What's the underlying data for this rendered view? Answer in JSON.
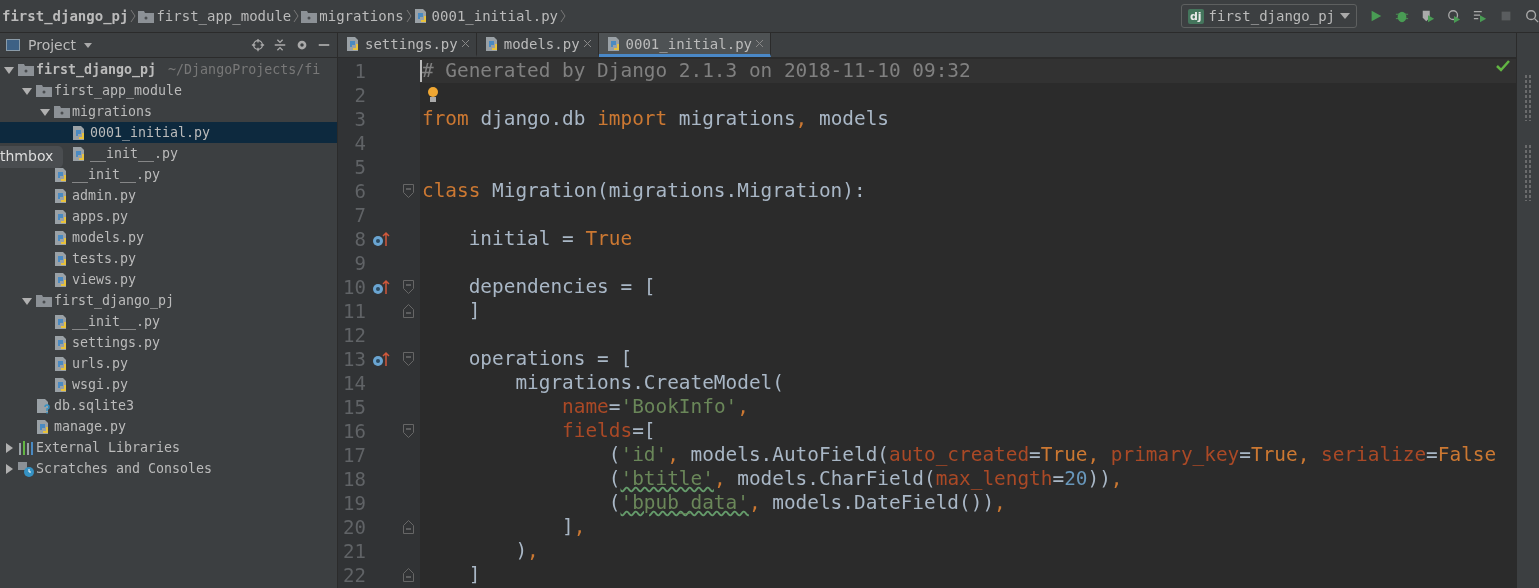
{
  "breadcrumbs": [
    {
      "label": "first_django_pj",
      "kind": "project"
    },
    {
      "label": "first_app_module",
      "kind": "folder"
    },
    {
      "label": "migrations",
      "kind": "folder"
    },
    {
      "label": "0001_initial.py",
      "kind": "python"
    }
  ],
  "run_config": {
    "label": "first_django_pj",
    "badge": "dj"
  },
  "project_panel": {
    "title": "Project",
    "overlay_tag": "thmbox",
    "tree": [
      {
        "name": "first_django_pj",
        "kind": "folder",
        "bold": true,
        "path": "~/DjangoProjects/fi",
        "expanded": true,
        "selected": false,
        "children": [
          {
            "name": "first_app_module",
            "kind": "folder",
            "bold": false,
            "expanded": true,
            "selected": false,
            "children": [
              {
                "name": "migrations",
                "kind": "folder",
                "bold": false,
                "expanded": true,
                "selected": false,
                "children": [
                  {
                    "name": "0001_initial.py",
                    "kind": "python",
                    "bold": false,
                    "selected": true
                  },
                  {
                    "name": "__init__.py",
                    "kind": "python",
                    "bold": false,
                    "selected": false
                  }
                ]
              },
              {
                "name": "__init__.py",
                "kind": "python",
                "bold": false,
                "selected": false
              },
              {
                "name": "admin.py",
                "kind": "python",
                "bold": false,
                "selected": false
              },
              {
                "name": "apps.py",
                "kind": "python",
                "bold": false,
                "selected": false
              },
              {
                "name": "models.py",
                "kind": "python",
                "bold": false,
                "selected": false
              },
              {
                "name": "tests.py",
                "kind": "python",
                "bold": false,
                "selected": false
              },
              {
                "name": "views.py",
                "kind": "python",
                "bold": false,
                "selected": false
              }
            ]
          },
          {
            "name": "first_django_pj",
            "kind": "folder",
            "bold": false,
            "expanded": true,
            "selected": false,
            "children": [
              {
                "name": "__init__.py",
                "kind": "python",
                "bold": false,
                "selected": false
              },
              {
                "name": "settings.py",
                "kind": "python",
                "bold": false,
                "selected": false
              },
              {
                "name": "urls.py",
                "kind": "python",
                "bold": false,
                "selected": false
              },
              {
                "name": "wsgi.py",
                "kind": "python",
                "bold": false,
                "selected": false
              }
            ]
          },
          {
            "name": "db.sqlite3",
            "kind": "unknown",
            "bold": false,
            "selected": false
          },
          {
            "name": "manage.py",
            "kind": "python",
            "bold": false,
            "selected": false
          }
        ]
      },
      {
        "name": "External Libraries",
        "kind": "library",
        "bold": false,
        "expanded": false,
        "selected": false
      },
      {
        "name": "Scratches and Consoles",
        "kind": "scratches",
        "bold": false,
        "expanded": false,
        "selected": false
      }
    ]
  },
  "tabs": [
    {
      "label": "settings.py",
      "selected": false
    },
    {
      "label": "models.py",
      "selected": false
    },
    {
      "label": "0001_initial.py",
      "selected": true
    }
  ],
  "editor": {
    "lines": [
      {
        "number": "1",
        "current": true,
        "override": false,
        "bulb": false,
        "fold_start": false,
        "fold_end": false,
        "tokens": [
          {
            "kind": "comment",
            "t": "# Generated by Django 2.1.3 on 2018-11-10 09:32"
          }
        ]
      },
      {
        "number": "2",
        "current": false,
        "override": false,
        "bulb": true,
        "fold_start": false,
        "fold_end": false
      },
      {
        "number": "3",
        "current": false,
        "override": false,
        "bulb": false,
        "fold_start": false,
        "fold_end": false,
        "tokens": [
          {
            "kind": "keyword",
            "t": "from"
          },
          {
            "kind": "plain",
            "t": " django.db "
          },
          {
            "kind": "keyword",
            "t": "import"
          },
          {
            "kind": "plain",
            "t": " migrations"
          },
          {
            "kind": "keyword",
            "t": ","
          },
          {
            "kind": "plain",
            "t": " models"
          }
        ]
      },
      {
        "number": "4",
        "current": false,
        "override": false,
        "bulb": false,
        "fold_start": false,
        "fold_end": false
      },
      {
        "number": "5",
        "current": false,
        "override": false,
        "bulb": false,
        "fold_start": false,
        "fold_end": false
      },
      {
        "number": "6",
        "current": false,
        "override": false,
        "bulb": false,
        "fold_start": true,
        "fold_end": false,
        "tokens": [
          {
            "kind": "keyword",
            "t": "class"
          },
          {
            "kind": "plain",
            "t": " Migration(migrations.Migration):"
          }
        ]
      },
      {
        "number": "7",
        "current": false,
        "override": false,
        "bulb": false,
        "fold_start": false,
        "fold_end": false
      },
      {
        "number": "8",
        "current": false,
        "override": true,
        "bulb": false,
        "fold_start": false,
        "fold_end": false,
        "tokens": [
          {
            "kind": "plain",
            "t": "    initial = "
          },
          {
            "kind": "keyword",
            "t": "True"
          }
        ]
      },
      {
        "number": "9",
        "current": false,
        "override": false,
        "bulb": false,
        "fold_start": false,
        "fold_end": false
      },
      {
        "number": "10",
        "current": false,
        "override": true,
        "bulb": false,
        "fold_start": true,
        "fold_end": false,
        "tokens": [
          {
            "kind": "plain",
            "t": "    dependencies = ["
          }
        ]
      },
      {
        "number": "11",
        "current": false,
        "override": false,
        "bulb": false,
        "fold_start": false,
        "fold_end": true,
        "tokens": [
          {
            "kind": "plain",
            "t": "    ]"
          }
        ]
      },
      {
        "number": "12",
        "current": false,
        "override": false,
        "bulb": false,
        "fold_start": false,
        "fold_end": false
      },
      {
        "number": "13",
        "current": false,
        "override": true,
        "bulb": false,
        "fold_start": true,
        "fold_end": false,
        "tokens": [
          {
            "kind": "plain",
            "t": "    operations = ["
          }
        ]
      },
      {
        "number": "14",
        "current": false,
        "override": false,
        "bulb": false,
        "fold_start": false,
        "fold_end": false,
        "tokens": [
          {
            "kind": "plain",
            "t": "        migrations.CreateModel("
          }
        ]
      },
      {
        "number": "15",
        "current": false,
        "override": false,
        "bulb": false,
        "fold_start": false,
        "fold_end": false,
        "tokens": [
          {
            "kind": "param",
            "t": "            name"
          },
          {
            "kind": "plain",
            "t": "="
          },
          {
            "kind": "string",
            "t": "'BookInfo'"
          },
          {
            "kind": "keyword",
            "t": ","
          }
        ]
      },
      {
        "number": "16",
        "current": false,
        "override": false,
        "bulb": false,
        "fold_start": true,
        "fold_end": false,
        "tokens": [
          {
            "kind": "param",
            "t": "            fields"
          },
          {
            "kind": "plain",
            "t": "=["
          }
        ]
      },
      {
        "number": "17",
        "current": false,
        "override": false,
        "bulb": false,
        "fold_start": false,
        "fold_end": false,
        "tokens": [
          {
            "kind": "plain",
            "t": "                ("
          },
          {
            "kind": "string",
            "t": "'id'"
          },
          {
            "kind": "keyword",
            "t": ","
          },
          {
            "kind": "plain",
            "t": " models.AutoField("
          },
          {
            "kind": "param",
            "t": "auto_created"
          },
          {
            "kind": "plain",
            "t": "="
          },
          {
            "kind": "keyword",
            "t": "True"
          },
          {
            "kind": "keyword",
            "t": ", "
          },
          {
            "kind": "param",
            "t": "primary_key"
          },
          {
            "kind": "plain",
            "t": "="
          },
          {
            "kind": "keyword",
            "t": "True"
          },
          {
            "kind": "keyword",
            "t": ", "
          },
          {
            "kind": "param",
            "t": "serialize"
          },
          {
            "kind": "plain",
            "t": "="
          },
          {
            "kind": "keyword",
            "t": "False"
          }
        ]
      },
      {
        "number": "18",
        "current": false,
        "override": false,
        "bulb": false,
        "fold_start": false,
        "fold_end": false,
        "tokens": [
          {
            "kind": "plain",
            "t": "                ("
          },
          {
            "kind": "typo",
            "t": "'btitle'"
          },
          {
            "kind": "keyword",
            "t": ","
          },
          {
            "kind": "plain",
            "t": " models.CharField("
          },
          {
            "kind": "param",
            "t": "max_length"
          },
          {
            "kind": "plain",
            "t": "="
          },
          {
            "kind": "number",
            "t": "20"
          },
          {
            "kind": "plain",
            "t": "))"
          },
          {
            "kind": "keyword",
            "t": ","
          }
        ]
      },
      {
        "number": "19",
        "current": false,
        "override": false,
        "bulb": false,
        "fold_start": false,
        "fold_end": false,
        "tokens": [
          {
            "kind": "plain",
            "t": "                ("
          },
          {
            "kind": "typo",
            "t": "'bpub_data'"
          },
          {
            "kind": "keyword",
            "t": ","
          },
          {
            "kind": "plain",
            "t": " models.DateField())"
          },
          {
            "kind": "keyword",
            "t": ","
          }
        ]
      },
      {
        "number": "20",
        "current": false,
        "override": false,
        "bulb": false,
        "fold_start": false,
        "fold_end": true,
        "tokens": [
          {
            "kind": "plain",
            "t": "            ]"
          },
          {
            "kind": "keyword",
            "t": ","
          }
        ]
      },
      {
        "number": "21",
        "current": false,
        "override": false,
        "bulb": false,
        "fold_start": false,
        "fold_end": false,
        "tokens": [
          {
            "kind": "plain",
            "t": "        )"
          },
          {
            "kind": "keyword",
            "t": ","
          }
        ]
      },
      {
        "number": "22",
        "current": false,
        "override": false,
        "bulb": false,
        "fold_start": false,
        "fold_end": true,
        "tokens": [
          {
            "kind": "plain",
            "t": "    ]"
          }
        ]
      }
    ]
  }
}
